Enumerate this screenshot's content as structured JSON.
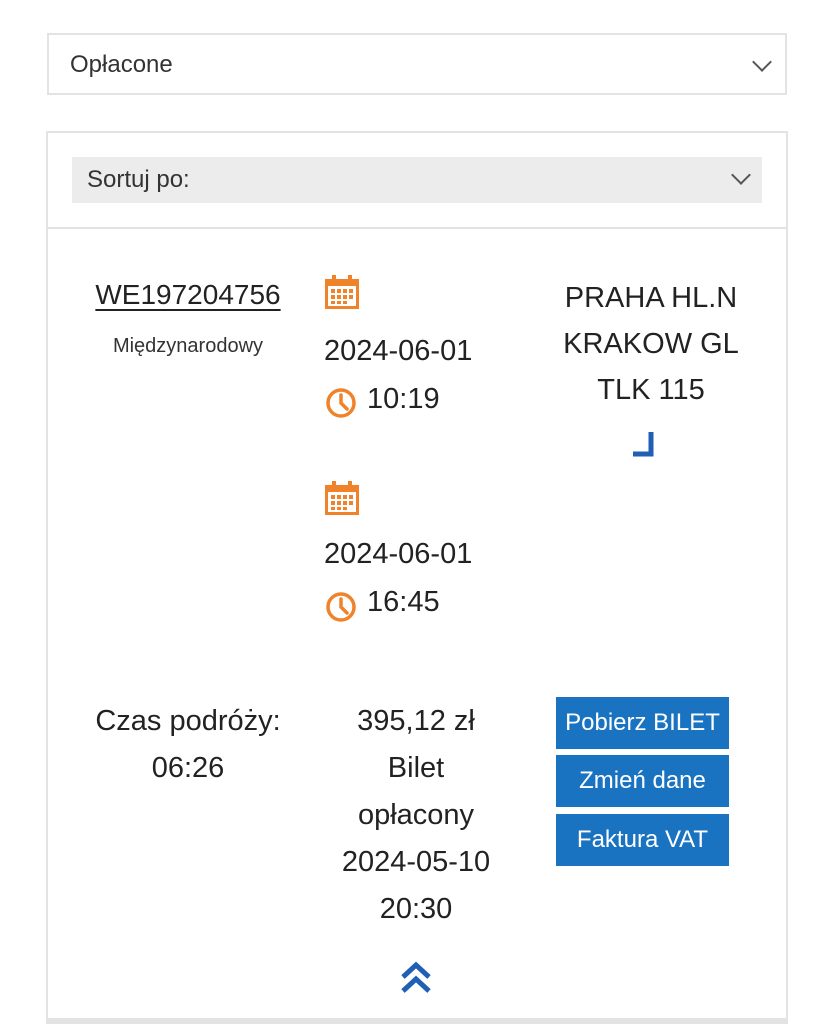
{
  "filters": {
    "status_selected": "Opłacone",
    "sort_label": "Sortuj po:"
  },
  "ticket": {
    "number": "WE197204756",
    "type": "Międzynarodowy",
    "departure": {
      "date": "2024-06-01",
      "time": "10:19"
    },
    "arrival": {
      "date": "2024-06-01",
      "time": "16:45"
    },
    "route": {
      "from": "PRAHA HL.N",
      "to": "KRAKOW GL",
      "train": "TLK 115"
    },
    "duration_label": "Czas podróży:",
    "duration_value": "06:26",
    "price": "395,12 zł",
    "status_line1": "Bilet",
    "status_line2": "opłacony",
    "paid_date": "2024-05-10",
    "paid_time": "20:30"
  },
  "actions": {
    "download": "Pobierz BILET",
    "change": "Zmień dane",
    "invoice": "Faktura VAT"
  },
  "colors": {
    "accent_orange": "#f0832a",
    "button_blue": "#1a73c0",
    "icon_blue": "#1f5fb5"
  },
  "icons": {
    "status_dropdown": "chevron-down-icon",
    "sort_dropdown": "chevron-down-icon",
    "date": "calendar-icon",
    "time": "clock-icon",
    "seat": "seat-icon",
    "collapse": "double-chevron-up-icon"
  }
}
